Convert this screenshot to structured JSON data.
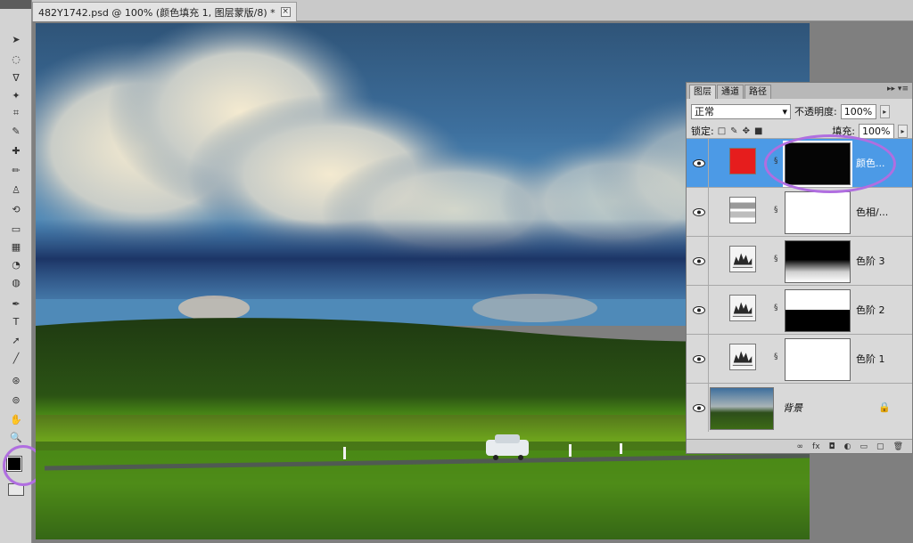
{
  "document": {
    "tab_title": "482Y1742.psd @ 100% (颜色填充 1, 图层蒙版/8) *",
    "close_glyph": "×"
  },
  "tools": [
    "move-tool",
    "marquee-tool",
    "lasso-tool",
    "quick-select-tool",
    "crop-tool",
    "eyedropper-tool",
    "healing-brush-tool",
    "brush-tool",
    "clone-stamp-tool",
    "history-brush-tool",
    "eraser-tool",
    "gradient-tool",
    "blur-tool",
    "dodge-tool",
    "pen-tool",
    "type-tool",
    "path-select-tool",
    "line-tool",
    "3d-rotate-tool",
    "3d-orbit-tool",
    "hand-tool",
    "zoom-tool"
  ],
  "colors": {
    "foreground": "#000000",
    "background": "#ffffff",
    "selection": "#4c9ae6",
    "highlight": "#b06ee0",
    "fill_swatch": "#e61d1d"
  },
  "panel": {
    "tabs": [
      "图层",
      "通道",
      "路径"
    ],
    "blend_mode": "正常",
    "opacity_label": "不透明度:",
    "opacity_value": "100%",
    "lock_label": "锁定:",
    "fill_label": "填充:",
    "fill_value": "100%",
    "layers": [
      {
        "name": "颜色...",
        "type": "color-fill",
        "selected": true,
        "mask": "black"
      },
      {
        "name": "色相/...",
        "type": "hue-saturation",
        "selected": false,
        "mask": "white"
      },
      {
        "name": "色阶 3",
        "type": "levels",
        "selected": false,
        "mask": "black-top-gradient"
      },
      {
        "name": "色阶 2",
        "type": "levels",
        "selected": false,
        "mask": "white-top-black-bottom"
      },
      {
        "name": "色阶 1",
        "type": "levels",
        "selected": false,
        "mask": "white"
      },
      {
        "name": "背景",
        "type": "background",
        "selected": false,
        "mask": "none"
      }
    ]
  }
}
